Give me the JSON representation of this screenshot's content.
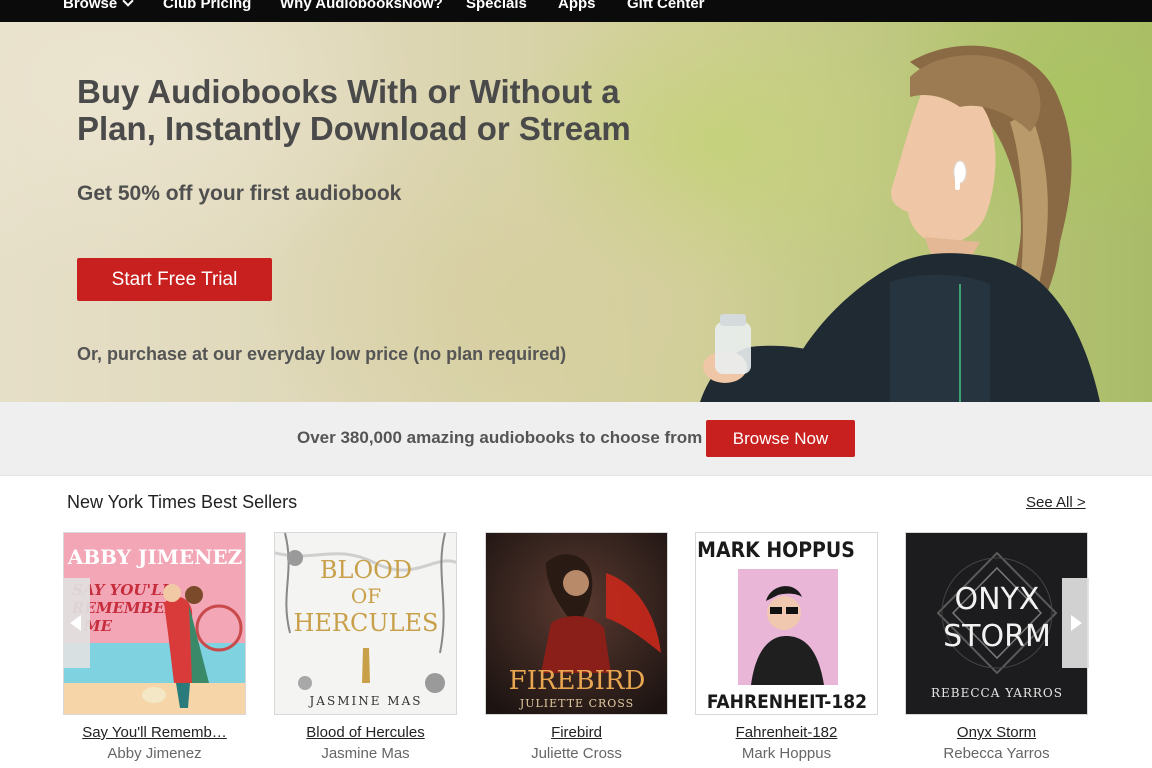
{
  "nav": {
    "items": [
      "Browse",
      "Club Pricing",
      "Why AudiobooksNow?",
      "Specials",
      "Apps",
      "Gift Center"
    ]
  },
  "hero": {
    "title": "Buy Audiobooks With or Without a Plan, Instantly Download or Stream",
    "subtitle": "Get 50% off your first audiobook",
    "cta_label": "Start Free Trial",
    "note": "Or, purchase at our everyday low price (no plan required)"
  },
  "band": {
    "text": "Over 380,000 amazing audiobooks to choose from",
    "button_label": "Browse Now"
  },
  "bestsellers": {
    "title": "New York Times Best Sellers",
    "see_all": "See All >",
    "books": [
      {
        "title": "Say You'll Rememb…",
        "author": "Abby Jimenez",
        "cover_text": [
          "ABBY JIMENEZ",
          "SAY YOU'LL",
          "REMEMBER",
          "ME"
        ]
      },
      {
        "title": "Blood of Hercules",
        "author": "Jasmine Mas",
        "cover_text": [
          "BLOOD",
          "OF",
          "HERCULES",
          "JASMINE MAS"
        ]
      },
      {
        "title": "Firebird",
        "author": "Juliette Cross",
        "cover_text": [
          "FIREBIRD",
          "JULIETTE CROSS"
        ]
      },
      {
        "title": "Fahrenheit-182",
        "author": "Mark Hoppus",
        "cover_text": [
          "MARK HOPPUS",
          "FAHRENHEIT-182"
        ]
      },
      {
        "title": "Onyx Storm",
        "author": "Rebecca Yarros",
        "cover_text": [
          "ONYX",
          "STORM",
          "REBECCA YARROS"
        ]
      }
    ]
  },
  "colors": {
    "accent_red": "#c8201f",
    "nav_bg": "#0b0b0b",
    "band_bg": "#efefef"
  }
}
